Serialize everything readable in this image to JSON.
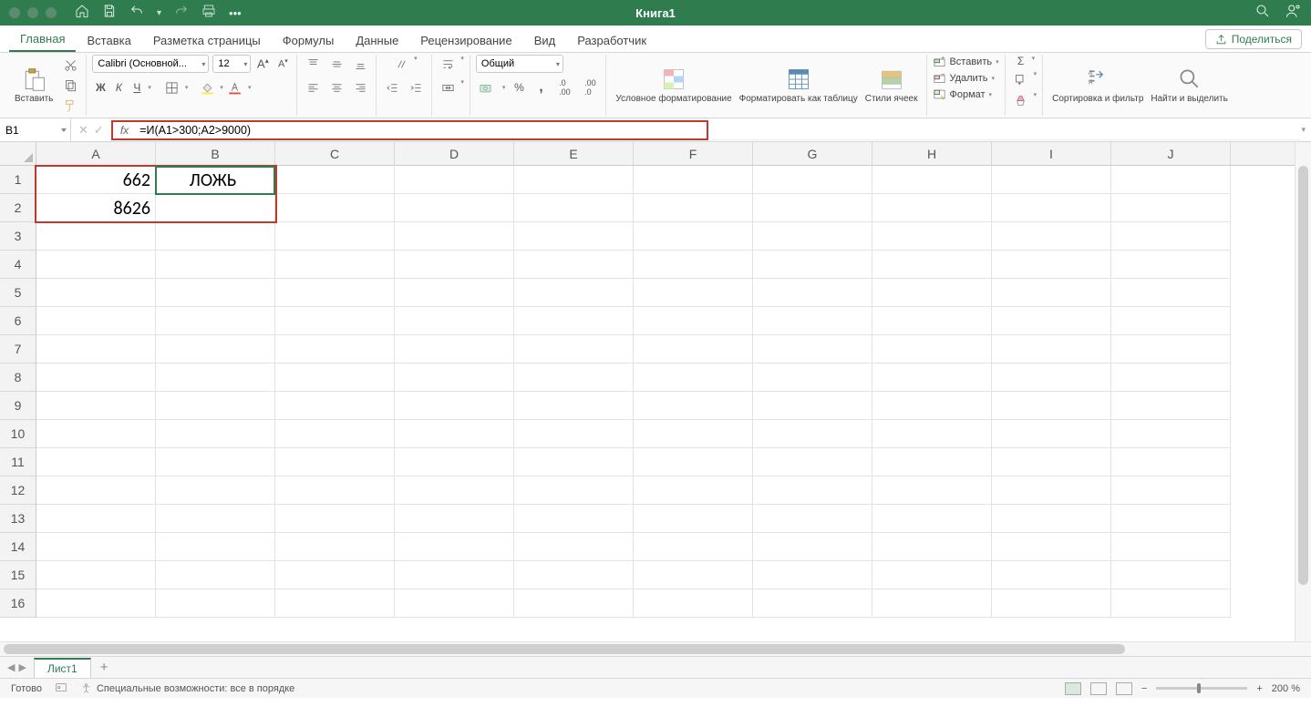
{
  "title": "Книга1",
  "tabs": [
    "Главная",
    "Вставка",
    "Разметка страницы",
    "Формулы",
    "Данные",
    "Рецензирование",
    "Вид",
    "Разработчик"
  ],
  "share": "Поделиться",
  "ribbon": {
    "paste": "Вставить",
    "font_name": "Calibri (Основной...",
    "font_size": "12",
    "number_format": "Общий",
    "cond_fmt": "Условное форматирование",
    "fmt_table": "Форматировать как таблицу",
    "cell_styles": "Стили ячеек",
    "insert": "Вставить",
    "delete": "Удалить",
    "format": "Формат",
    "sort_filter": "Сортировка и фильтр",
    "find_select": "Найти и выделить"
  },
  "namebox": "B1",
  "formula": "=И(A1>300;A2>9000)",
  "columns": [
    "A",
    "B",
    "C",
    "D",
    "E",
    "F",
    "G",
    "H",
    "I",
    "J"
  ],
  "rows": [
    "1",
    "2",
    "3",
    "4",
    "5",
    "6",
    "7",
    "8",
    "9",
    "10",
    "11",
    "12",
    "13",
    "14",
    "15",
    "16"
  ],
  "cell_A1": "662",
  "cell_A2": "8626",
  "cell_B1": "ЛОЖЬ",
  "sheet": "Лист1",
  "status_ready": "Готово",
  "status_acc": "Специальные возможности: все в порядке",
  "zoom": "200 %"
}
